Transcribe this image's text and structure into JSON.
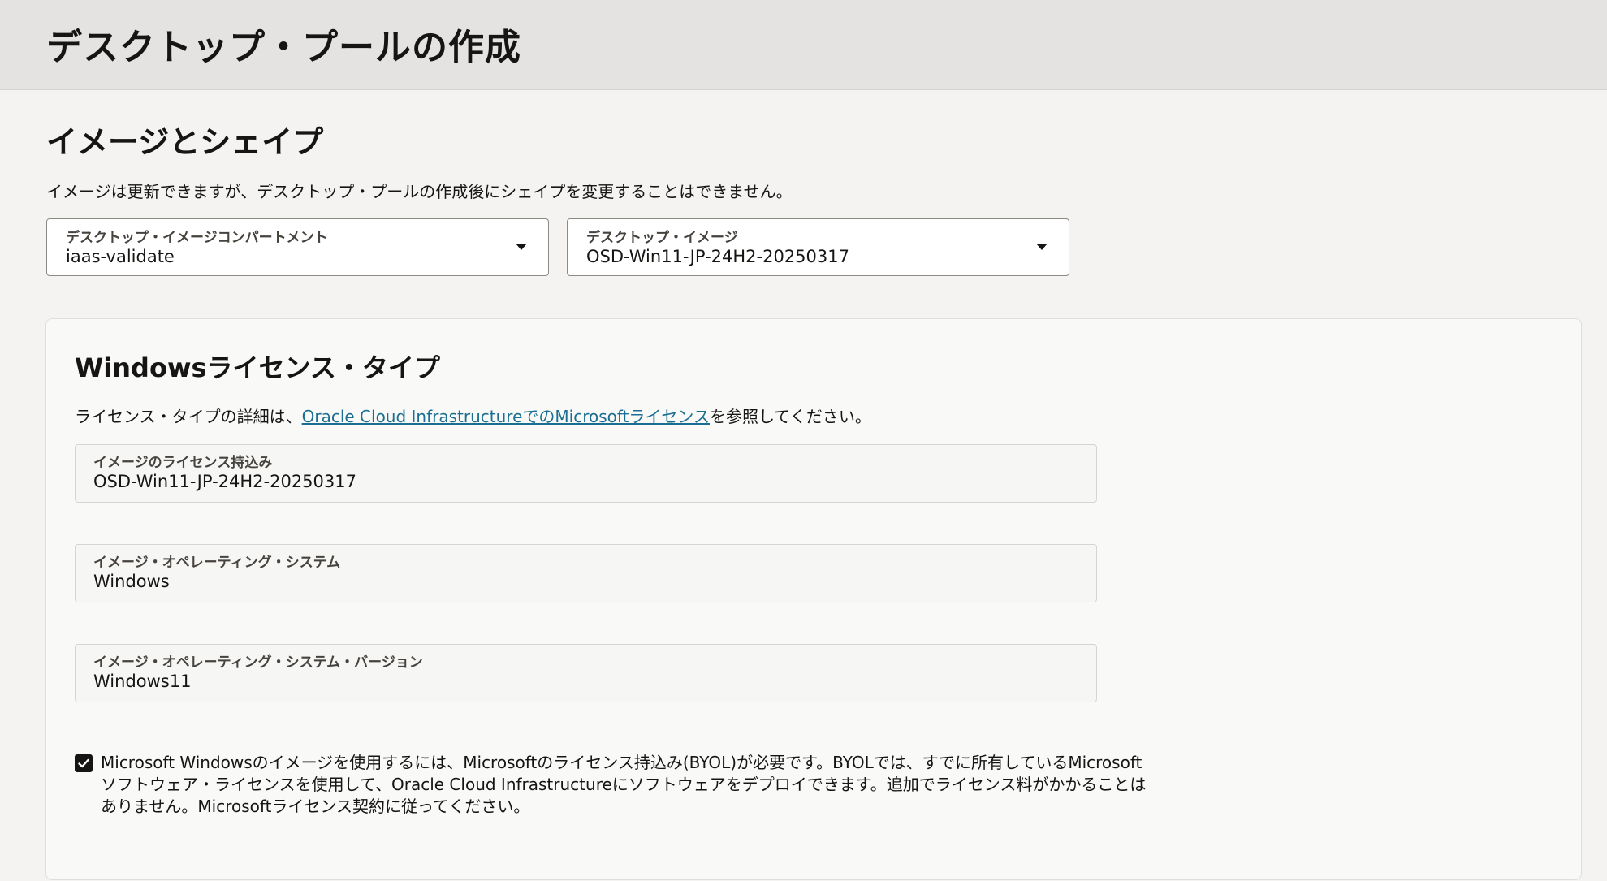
{
  "header": {
    "title": "デスクトップ・プールの作成"
  },
  "image_shape": {
    "title": "イメージとシェイプ",
    "description": "イメージは更新できますが、デスクトップ・プールの作成後にシェイプを変更することはできません。",
    "compartment": {
      "label": "デスクトップ・イメージコンパートメント",
      "value": "iaas-validate"
    },
    "image": {
      "label": "デスクトップ・イメージ",
      "value": "OSD-Win11-JP-24H2-20250317"
    }
  },
  "license": {
    "title": "Windowsライセンス・タイプ",
    "desc_prefix": "ライセンス・タイプの詳細は、",
    "desc_link": "Oracle Cloud InfrastructureでのMicrosoftライセンス",
    "desc_suffix": "を参照してください。",
    "fields": [
      {
        "label": "イメージのライセンス持込み",
        "value": "OSD-Win11-JP-24H2-20250317"
      },
      {
        "label": "イメージ・オペレーティング・システム",
        "value": "Windows"
      },
      {
        "label": "イメージ・オペレーティング・システム・バージョン",
        "value": "Windows11"
      }
    ],
    "byol_checked": true,
    "byol_text": "Microsoft Windowsのイメージを使用するには、Microsoftのライセンス持込み(BYOL)が必要です。BYOLでは、すでに所有しているMicrosoftソフトウェア・ライセンスを使用して、Oracle Cloud Infrastructureにソフトウェアをデプロイできます。追加でライセンス料がかかることはありません。Microsoftライセンス契約に従ってください。"
  }
}
